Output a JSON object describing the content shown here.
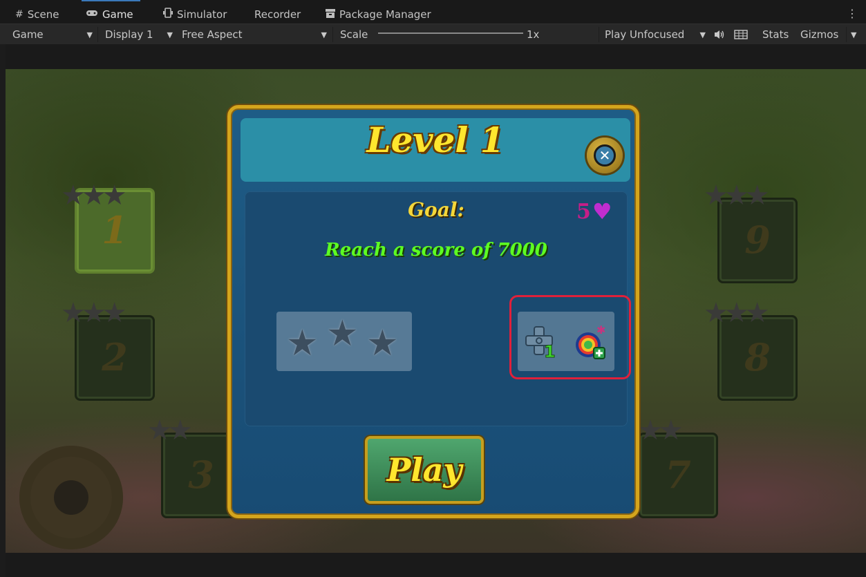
{
  "editor": {
    "tabs": [
      {
        "label": "Scene",
        "icon": "scene-grid-icon"
      },
      {
        "label": "Game",
        "icon": "gamepad-icon",
        "active": true
      },
      {
        "label": "Simulator",
        "icon": "device-icon"
      },
      {
        "label": "Recorder"
      },
      {
        "label": "Package Manager",
        "icon": "package-icon"
      }
    ],
    "toolbar": {
      "view_select": "Game",
      "display_select": "Display 1",
      "aspect_select": "Free Aspect",
      "scale_label": "Scale",
      "scale_value": "1x",
      "play_mode": "Play Unfocused",
      "stats": "Stats",
      "gizmos": "Gizmos"
    }
  },
  "game": {
    "background_levels": [
      "1",
      "2",
      "3",
      "7",
      "8",
      "9"
    ],
    "popup": {
      "title": "Level 1",
      "goal_label": "Goal:",
      "goal_text": "Reach a score of 7000",
      "lives": "5",
      "star_count": 3,
      "boosters": [
        {
          "icon": "move-plus-one-booster-icon"
        },
        {
          "icon": "rainbow-bomb-booster-icon"
        }
      ],
      "play_label": "Play"
    }
  },
  "colors": {
    "title": "#ffe62e",
    "goal_text": "#5dff22",
    "lives": "#c71e88",
    "highlight": "#e0203a",
    "popup_border": "#d4a51c"
  }
}
